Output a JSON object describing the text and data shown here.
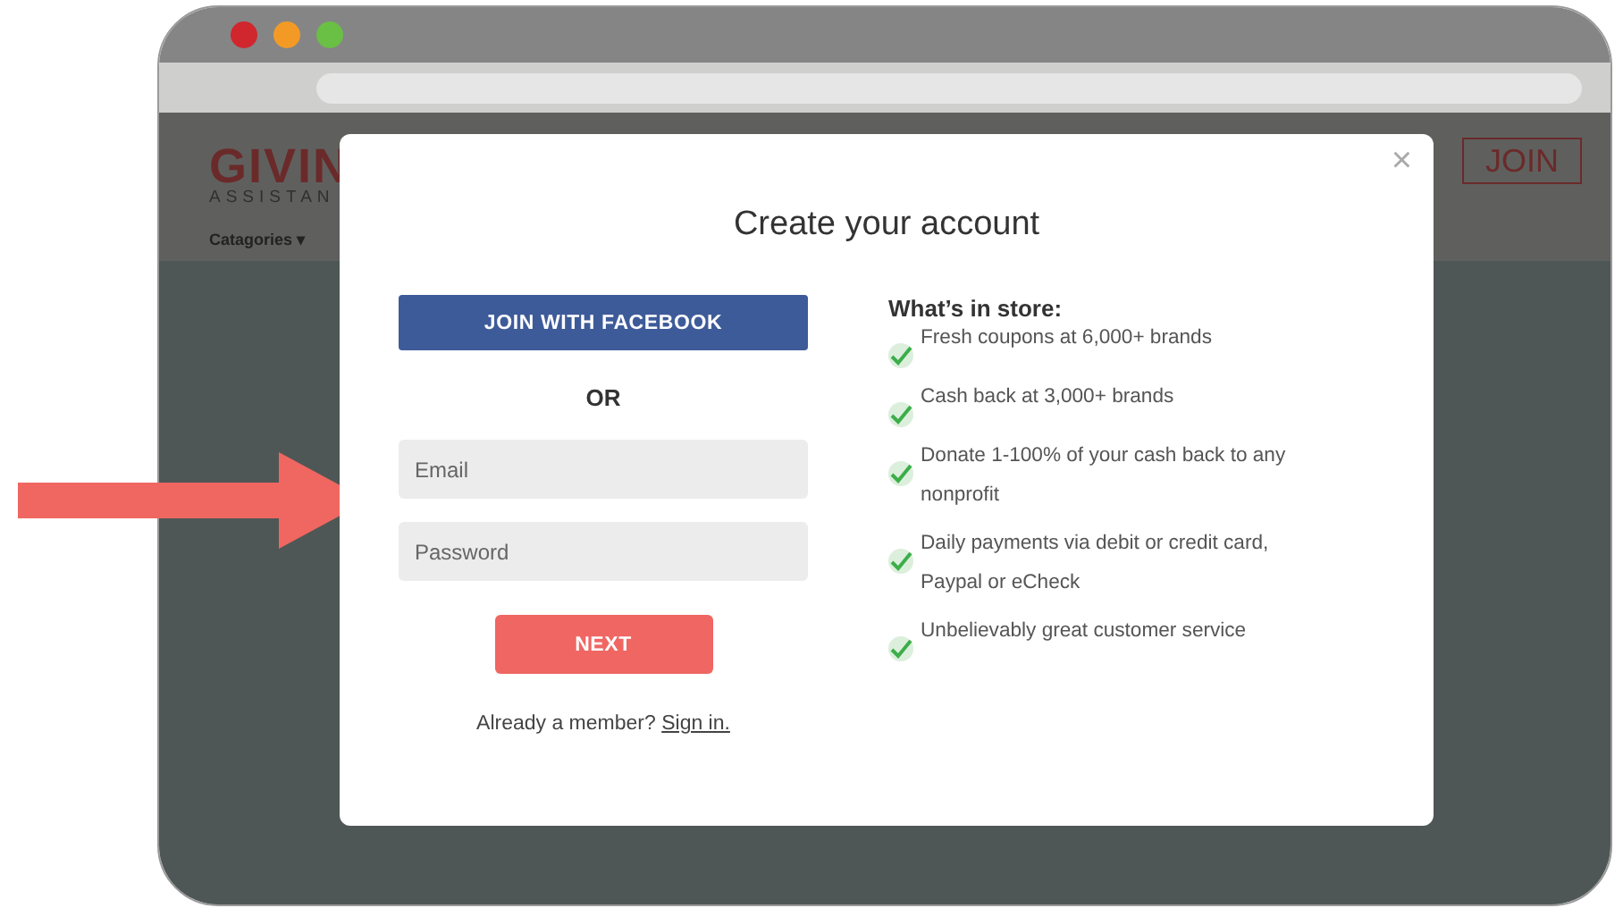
{
  "browser": {
    "window_controls": [
      {
        "color": "#d0262e"
      },
      {
        "color": "#f39a26"
      },
      {
        "color": "#6abf45"
      }
    ]
  },
  "site_header": {
    "logo_word": "GIVIN",
    "logo_sub": "ASSISTAN",
    "nav_item": "Catagories ▾",
    "join_button": "JOIN"
  },
  "modal": {
    "title": "Create your account",
    "close": "×",
    "facebook_button": "JOIN WITH FACEBOOK",
    "divider": "OR",
    "fields": [
      {
        "placeholder": "Email"
      },
      {
        "placeholder": "Password"
      }
    ],
    "next_button": "NEXT",
    "signin_prompt": "Already a member?",
    "signin_link": "Sign in.",
    "benefits_heading": "What’s in store:",
    "benefits": [
      "Fresh coupons at 6,000+ brands",
      "Cash back at 3,000+ brands",
      "Donate 1-100% of your cash back to any nonprofit",
      "Daily payments via debit or credit card, Paypal or eCheck",
      "Unbelievably great customer service"
    ]
  }
}
